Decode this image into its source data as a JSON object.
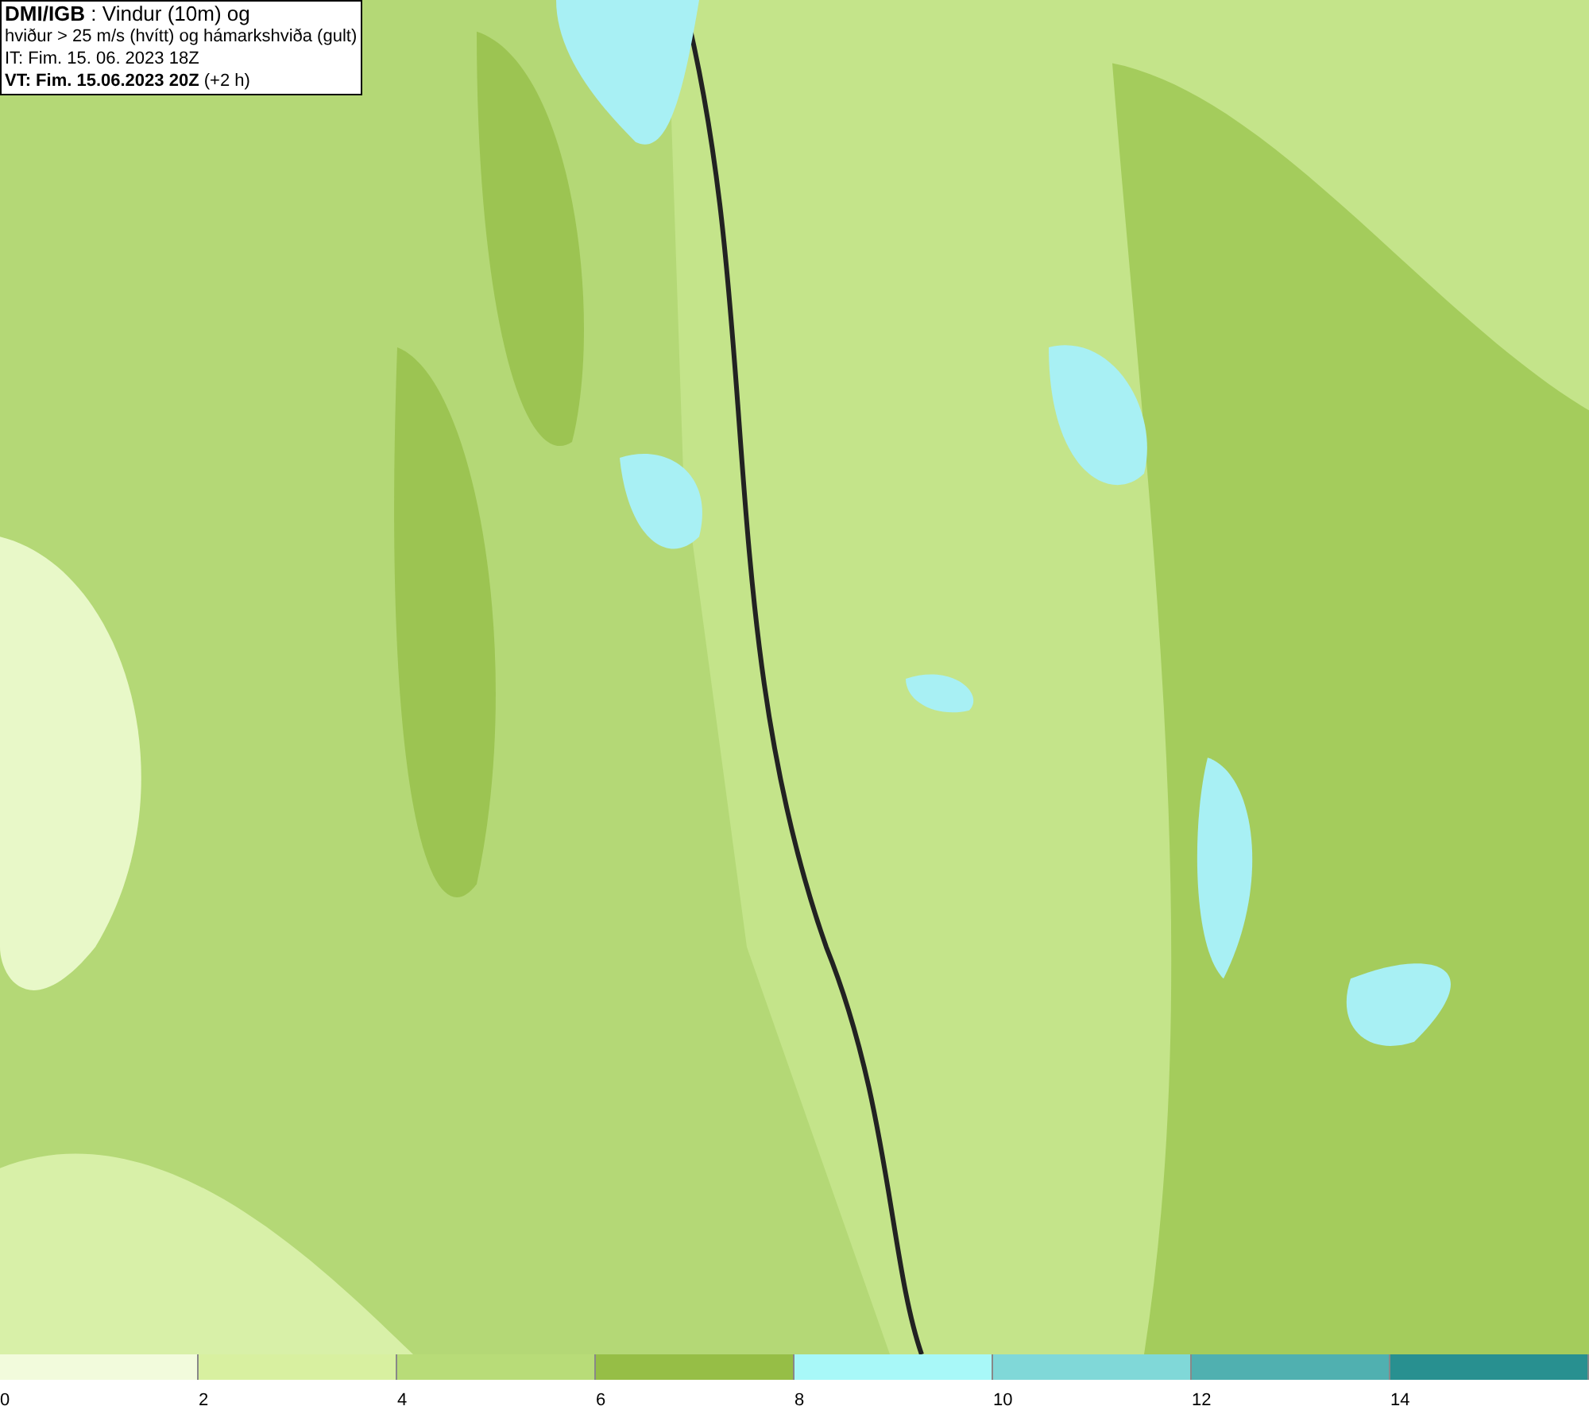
{
  "header": {
    "lines": [
      "**DMI/IGB** : Vindur (10m) og",
      "hviður > 25 m/s (hvítt) og hámarkshviða (gult)",
      "IT: Fim. 15. 06. 2023 18Z",
      "**VT: Fim. 15.06.2023 20Z** (+2 h)"
    ]
  },
  "legend": {
    "segments": [
      {
        "color": "#f2fbdc",
        "label": "0"
      },
      {
        "color": "#d8f0a0",
        "label": "2"
      },
      {
        "color": "#b8dc78",
        "label": "4"
      },
      {
        "color": "#96be46",
        "label": "6"
      },
      {
        "color": "#a8f8f8",
        "label": "8"
      },
      {
        "color": "#80d8d8",
        "label": "10"
      },
      {
        "color": "#50b0b0",
        "label": "12"
      },
      {
        "color": "#289090",
        "label": "14"
      }
    ]
  }
}
